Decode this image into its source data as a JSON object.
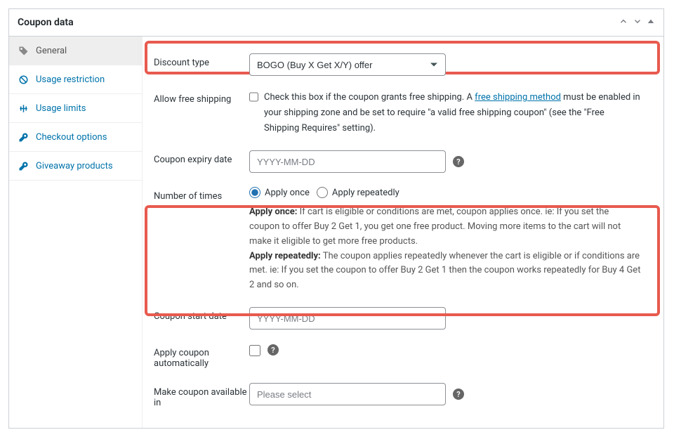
{
  "panel": {
    "title": "Coupon data"
  },
  "sidebar": {
    "items": [
      {
        "label": "General"
      },
      {
        "label": "Usage restriction"
      },
      {
        "label": "Usage limits"
      },
      {
        "label": "Checkout options"
      },
      {
        "label": "Giveaway products"
      }
    ]
  },
  "form": {
    "discount_type": {
      "label": "Discount type",
      "value": "BOGO (Buy X Get X/Y) offer"
    },
    "free_shipping": {
      "label": "Allow free shipping",
      "text1": "Check this box if the coupon grants free shipping. A ",
      "link": "free shipping method",
      "text2": " must be enabled in your shipping zone and be set to require \"a valid free shipping coupon\" (see the \"Free Shipping Requires\" setting)."
    },
    "expiry": {
      "label": "Coupon expiry date",
      "placeholder": "YYYY-MM-DD"
    },
    "number_of_times": {
      "label": "Number of times",
      "opt1": "Apply once",
      "opt2": "Apply repeatedly",
      "desc_once_label": "Apply once:",
      "desc_once": " If cart is eligible or conditions are met, coupon applies once. ie: If you set the coupon to offer Buy 2 Get 1, you get one free product. Moving more items to the cart will not make it eligible to get more free products.",
      "desc_rep_label": "Apply repeatedly:",
      "desc_rep": " The coupon applies repeatedly whenever the cart is eligible or if conditions are met. ie: If you set the coupon to offer Buy 2 Get 1 then the coupon works repeatedly for Buy 4 Get 2 and so on."
    },
    "start_date": {
      "label": "Coupon start date",
      "placeholder": "YYYY-MM-DD"
    },
    "apply_auto": {
      "label": "Apply coupon automatically"
    },
    "available_in": {
      "label": "Make coupon available in",
      "placeholder": "Please select"
    }
  }
}
